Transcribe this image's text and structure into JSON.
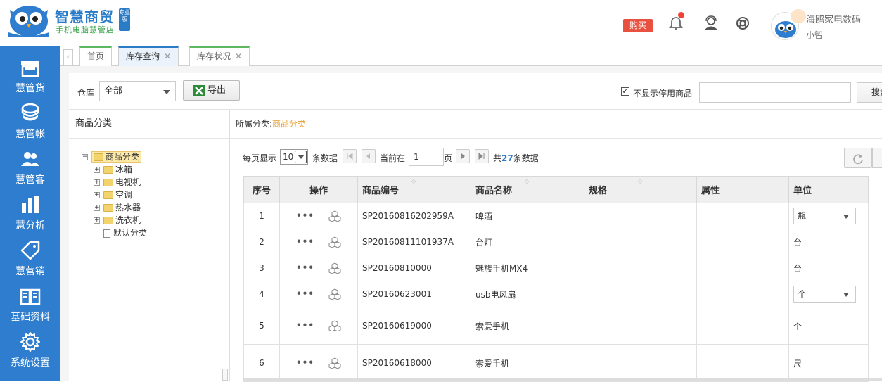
{
  "brand": {
    "title": "智慧商贸",
    "badge": "专业版",
    "subtitle": "手机电脑慧管店"
  },
  "header": {
    "buy_label": "购买",
    "user_name": "海鸥家电数码",
    "user_sub": "小智"
  },
  "sidebar": {
    "items": [
      {
        "label": "慧管货",
        "icon": "store-icon"
      },
      {
        "label": "慧管帐",
        "icon": "coins-icon"
      },
      {
        "label": "慧管客",
        "icon": "users-icon"
      },
      {
        "label": "慧分析",
        "icon": "bar-chart-icon"
      },
      {
        "label": "慧营销",
        "icon": "tag-icon"
      },
      {
        "label": "基础资料",
        "icon": "book-icon"
      },
      {
        "label": "系统设置",
        "icon": "gear-icon"
      }
    ]
  },
  "tabs": [
    {
      "label": "首页",
      "closable": false
    },
    {
      "label": "库存查询",
      "closable": true,
      "active": true
    },
    {
      "label": "库存状况",
      "closable": true
    }
  ],
  "toolbar": {
    "warehouse_label": "仓库",
    "warehouse_value": "全部",
    "export_label": "导出",
    "hide_disabled_label": "不显示停用商品",
    "hide_disabled_checked": true,
    "search_label": "搜索"
  },
  "tree": {
    "title": "商品分类",
    "root": "商品分类",
    "children": [
      "冰箱",
      "电视机",
      "空调",
      "热水器",
      "洗衣机"
    ],
    "leaf": "默认分类"
  },
  "grid": {
    "category_prefix": "所属分类:",
    "category_value": "商品分类",
    "pager": {
      "per_page_label": "每页显示",
      "per_page_value": "10",
      "records_label": "条数据",
      "current_label": "当前在",
      "page_value": "1",
      "page_unit": "页",
      "total_prefix": "共",
      "total_count": "27",
      "total_suffix": "条数据"
    },
    "columns": [
      "序号",
      "操作",
      "商品编号",
      "商品名称",
      "规格",
      "属性",
      "单位"
    ],
    "rows": [
      {
        "no": "1",
        "code": "SP20160816202959A",
        "name": "啤酒",
        "unit": "瓶",
        "unit_select": true
      },
      {
        "no": "2",
        "code": "SP20160811101937A",
        "name": "台灯",
        "unit": "台",
        "unit_select": false
      },
      {
        "no": "3",
        "code": "SP20160810000",
        "name": "魅族手机MX4",
        "unit": "台",
        "unit_select": false
      },
      {
        "no": "4",
        "code": "SP20160623001",
        "name": "usb电风扇",
        "unit": "个",
        "unit_select": true
      },
      {
        "no": "5",
        "code": "SP20160619000",
        "name": "索爱手机",
        "unit": "个",
        "unit_select": false
      },
      {
        "no": "6",
        "code": "SP20160618000",
        "name": "索爱手机",
        "unit": "尺",
        "unit_select": false
      }
    ],
    "ops_label": "•••"
  }
}
